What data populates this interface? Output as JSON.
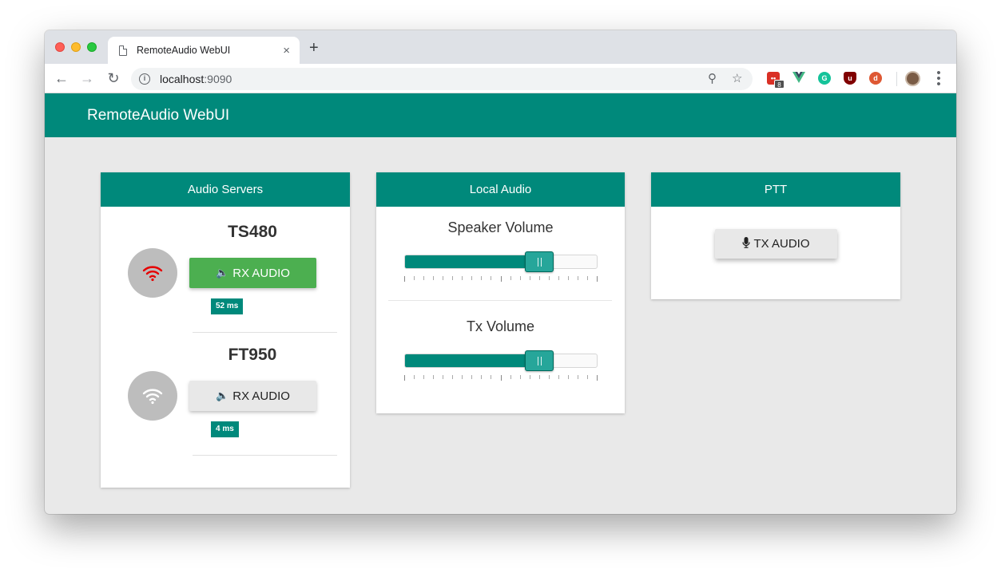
{
  "browser": {
    "tab_title": "RemoteAudio WebUI",
    "tab_close": "×",
    "new_tab": "+",
    "url_host": "localhost",
    "url_port": ":9090",
    "extension_badge": "8"
  },
  "app": {
    "title": "RemoteAudio WebUI"
  },
  "audio_servers": {
    "header": "Audio Servers",
    "servers": [
      {
        "name": "TS480",
        "rx_label": "RX AUDIO",
        "latency": "52 ms",
        "connected": true
      },
      {
        "name": "FT950",
        "rx_label": "RX AUDIO",
        "latency": "4 ms",
        "connected": false
      }
    ]
  },
  "local_audio": {
    "header": "Local Audio",
    "speaker": {
      "label": "Speaker Volume",
      "level": 0.7
    },
    "tx": {
      "label": "Tx Volume",
      "level": 0.7
    }
  },
  "ptt": {
    "header": "PTT",
    "button_label": "TX AUDIO"
  },
  "colors": {
    "primary": "#00897b",
    "active_button": "#4caf50",
    "wifi_connected": "#e60000",
    "wifi_disconnected": "#ffffff"
  },
  "icons": {
    "speaker": "volume-up-icon",
    "mic": "microphone-icon",
    "wifi": "wifi-icon"
  }
}
